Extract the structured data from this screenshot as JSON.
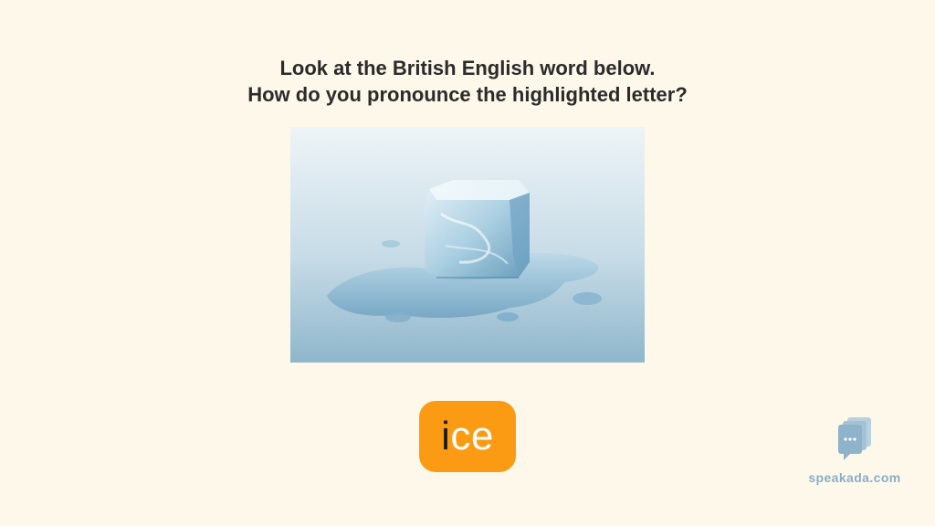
{
  "question": {
    "line1": "Look at the British English word below.",
    "line2": "How do you pronounce the highlighted letter?"
  },
  "image": {
    "subject": "melting-ice-cube"
  },
  "word": {
    "highlighted": "i",
    "rest": "ce",
    "background_color": "#fb9b14",
    "highlight_color": "#1b1b1b",
    "text_color": "#ffffff"
  },
  "brand": {
    "name": "speakada.com",
    "icon": "chat-cards-icon"
  }
}
